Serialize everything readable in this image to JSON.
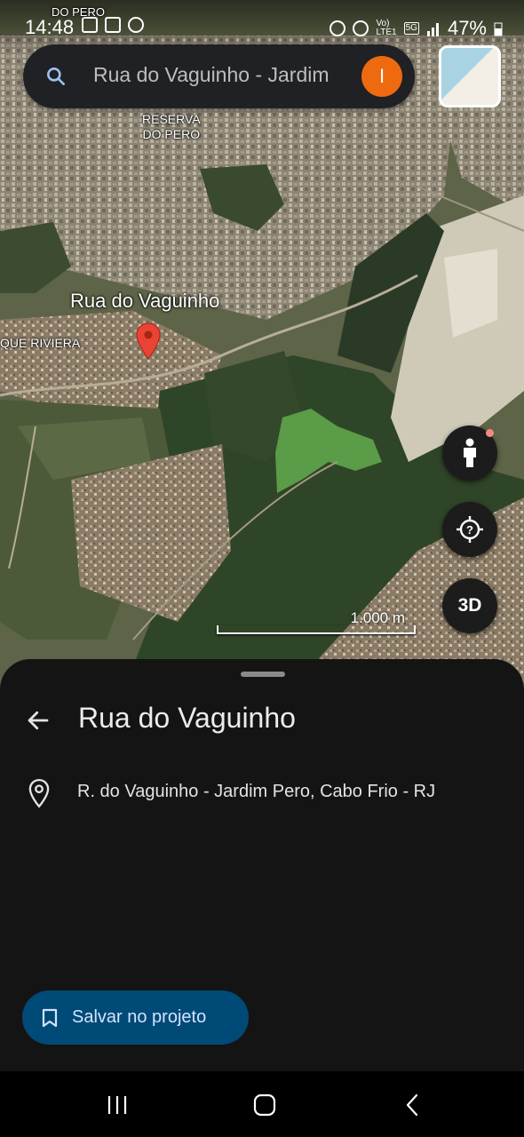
{
  "status_bar": {
    "time": "14:48",
    "network_small_top": "Vo)",
    "network_small_bottom": "LTE1",
    "network_5g": "5G",
    "battery": "47%"
  },
  "search": {
    "query": "Rua do Vaguinho - Jardim",
    "avatar_letter": "I"
  },
  "map": {
    "labels": {
      "top_partial": "DO PERO",
      "reserva_line1": "RESERVA",
      "reserva_line2": "DO PERO",
      "street": "Rua do Vaguinho",
      "riviera": "QUE RIVIERA"
    },
    "scale_label": "1.000 m",
    "button_3d": "3D"
  },
  "sheet": {
    "title": "Rua do Vaguinho",
    "address": "R. do Vaguinho - Jardim Pero, Cabo Frio - RJ",
    "save_label": "Salvar no projeto"
  },
  "colors": {
    "avatar": "#ee6a0f",
    "pin": "#ea4335",
    "save_button": "#004a77"
  }
}
